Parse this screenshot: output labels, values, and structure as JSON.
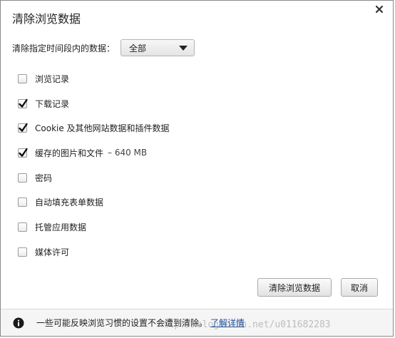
{
  "dialog": {
    "title": "清除浏览数据"
  },
  "time_range": {
    "label": "清除指定时间段内的数据：",
    "selected": "全部"
  },
  "options": [
    {
      "label": "浏览记录",
      "checked": false,
      "extra": ""
    },
    {
      "label": "下载记录",
      "checked": true,
      "extra": ""
    },
    {
      "label": "Cookie 及其他网站数据和插件数据",
      "checked": true,
      "extra": ""
    },
    {
      "label": "缓存的图片和文件",
      "checked": true,
      "extra": "–  640 MB"
    },
    {
      "label": "密码",
      "checked": false,
      "extra": ""
    },
    {
      "label": "自动填充表单数据",
      "checked": false,
      "extra": ""
    },
    {
      "label": "托管应用数据",
      "checked": false,
      "extra": ""
    },
    {
      "label": "媒体许可",
      "checked": false,
      "extra": ""
    }
  ],
  "buttons": {
    "clear_label": "清除浏览数据",
    "cancel_label": "取消"
  },
  "footer": {
    "text": "一些可能反映浏览习惯的设置不会遭到清除。",
    "link": "了解详情"
  },
  "watermark": {
    "text": "http://blog.csdn.net/u011682283"
  }
}
